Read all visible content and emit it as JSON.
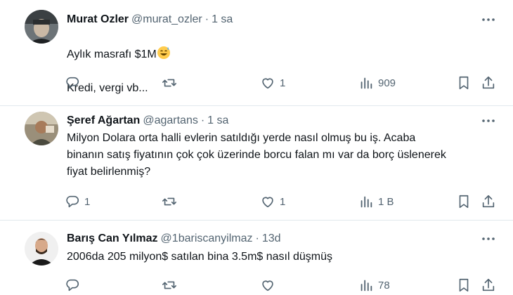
{
  "tweets": [
    {
      "name": "Murat Ozler",
      "handle": "@murat_ozler",
      "dot": "·",
      "time": "1 sa",
      "text_line1": "Aylık masrafı $1M",
      "text_line2": "Kredi, vergi vb...",
      "emoji": "grinning-face-with-sweat",
      "reply_count": "",
      "retweet_count": "",
      "like_count": "1",
      "view_count": "909"
    },
    {
      "name": "Şeref Ağartan",
      "handle": "@agartans",
      "dot": "·",
      "time": "1 sa",
      "text": "Milyon Dolara orta halli evlerin satıldığı yerde nasıl olmuş bu iş. Acaba\nbinanın satış fiyatının çok çok üzerinde borcu falan mı var da borç üslenerek\nfiyat belirlenmiş?",
      "reply_count": "1",
      "retweet_count": "",
      "like_count": "1",
      "view_count": "1 B"
    },
    {
      "name": "Barış Can Yılmaz",
      "handle": "@1bariscanyilmaz",
      "dot": "·",
      "time": "13d",
      "text": "2006da 205 milyon$ satılan bina 3.5m$ nasıl düşmüş",
      "reply_count": "",
      "retweet_count": "",
      "like_count": "",
      "view_count": "78"
    }
  ],
  "colors": {
    "text": "#0f1419",
    "secondary": "#536471",
    "divider": "#e1e8ed"
  },
  "icons": [
    "more-icon",
    "reply-icon",
    "retweet-icon",
    "like-icon",
    "views-icon",
    "bookmark-icon",
    "share-icon"
  ]
}
